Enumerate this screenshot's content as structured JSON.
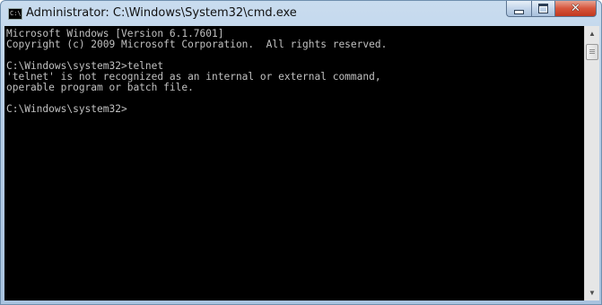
{
  "window": {
    "title": "Administrator: C:\\Windows\\System32\\cmd.exe",
    "icon": "cmd-icon",
    "buttons": {
      "minimize": "minimize-icon",
      "maximize": "maximize-icon",
      "close": "close-icon"
    }
  },
  "console": {
    "lines": [
      "Microsoft Windows [Version 6.1.7601]",
      "Copyright (c) 2009 Microsoft Corporation.  All rights reserved.",
      "",
      "C:\\Windows\\system32>telnet",
      "'telnet' is not recognized as an internal or external command,",
      "operable program or batch file.",
      "",
      "C:\\Windows\\system32>"
    ],
    "text_color": "#c0c0c0",
    "background": "#000000"
  },
  "scrollbar": {
    "up_icon": "scroll-up-icon",
    "down_icon": "scroll-down-icon"
  }
}
